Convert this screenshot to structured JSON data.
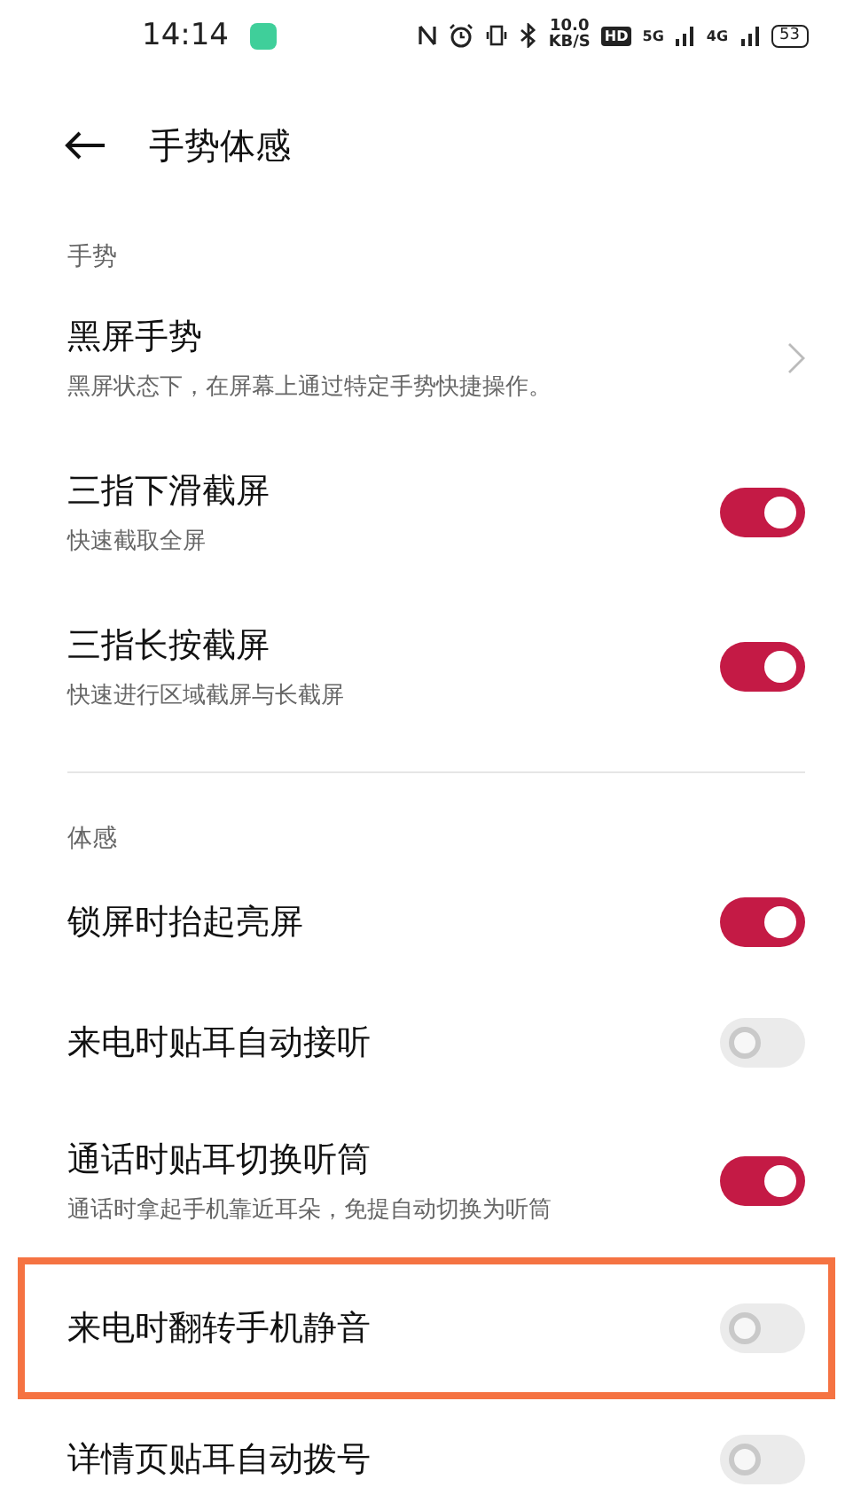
{
  "status_bar": {
    "time": "14:14",
    "speed": "10.0",
    "speed_unit": "KB/S",
    "hd": "HD",
    "net1": "5G",
    "net2": "4G",
    "battery": "53"
  },
  "header": {
    "title": "手势体感"
  },
  "sections": [
    {
      "label": "手势",
      "items": [
        {
          "kind": "link",
          "title": "黑屏手势",
          "subtitle": "黑屏状态下，在屏幕上通过特定手势快捷操作。",
          "highlighted": false
        },
        {
          "kind": "toggle",
          "title": "三指下滑截屏",
          "subtitle": "快速截取全屏",
          "on": true,
          "highlighted": false
        },
        {
          "kind": "toggle",
          "title": "三指长按截屏",
          "subtitle": "快速进行区域截屏与长截屏",
          "on": true,
          "highlighted": false
        }
      ]
    },
    {
      "label": "体感",
      "items": [
        {
          "kind": "toggle",
          "title": "锁屏时抬起亮屏",
          "on": true,
          "highlighted": false
        },
        {
          "kind": "toggle",
          "title": "来电时贴耳自动接听",
          "on": false,
          "highlighted": false
        },
        {
          "kind": "toggle",
          "title": "通话时贴耳切换听筒",
          "subtitle": "通话时拿起手机靠近耳朵，免提自动切换为听筒",
          "on": true,
          "highlighted": false
        },
        {
          "kind": "toggle",
          "title": "来电时翻转手机静音",
          "on": false,
          "highlighted": true
        },
        {
          "kind": "toggle",
          "title": "详情页贴耳自动拨号",
          "on": false,
          "highlighted": false
        }
      ]
    }
  ]
}
